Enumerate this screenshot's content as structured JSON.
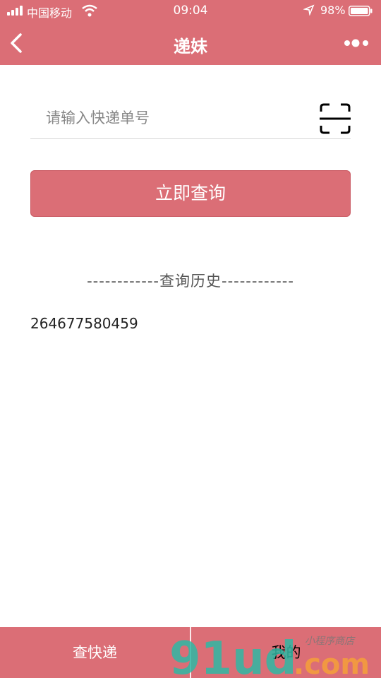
{
  "status_bar": {
    "carrier": "中国移动",
    "time": "09:04",
    "battery": "98%"
  },
  "nav": {
    "title": "递妹",
    "icons": [
      "back-arrow-icon",
      "more-dots-icon"
    ]
  },
  "search": {
    "placeholder": "请输入快递单号",
    "value": "",
    "scan_icon": "scan-icon"
  },
  "query_button": {
    "label": "立即查询"
  },
  "history": {
    "title": "------------查询历史------------",
    "items": [
      "264677580459"
    ]
  },
  "tabbar": {
    "tabs": [
      {
        "label": "查快递",
        "active": false
      },
      {
        "label": "我的",
        "active": true
      }
    ]
  },
  "watermark": {
    "text": "91ud.com",
    "subtitle": "小程序商店"
  },
  "colors": {
    "primary": "#db6e76",
    "background": "#ffffff"
  }
}
